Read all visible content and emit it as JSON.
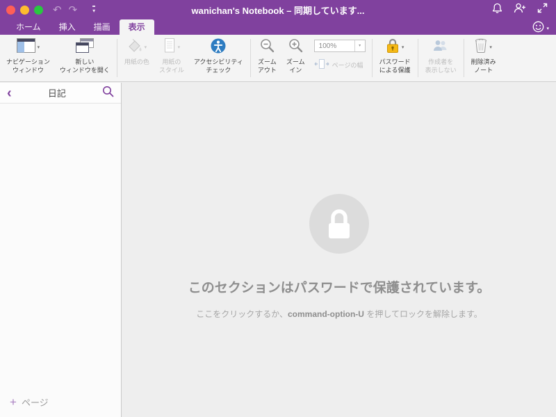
{
  "titlebar": {
    "title": "wanichan's Notebook – 同期しています...",
    "undo": "↶",
    "redo": "↷"
  },
  "tabs": {
    "home": "ホーム",
    "insert": "挿入",
    "draw": "描画",
    "view": "表示"
  },
  "ribbon": {
    "navigation_window": "ナビゲーション\nウィンドウ",
    "new_window": "新しい\nウィンドウを開く",
    "paper_color": "用紙の色",
    "paper_style": "用紙の\nスタイル",
    "accessibility_check": "アクセシビリティ\nチェック",
    "zoom_out": "ズーム\nアウト",
    "zoom_in": "ズーム\nイン",
    "zoom_level": "100%",
    "page_width": "ページの幅",
    "password_protect": "パスワード\nによる保護",
    "hide_authors": "作成者を\n表示しない",
    "deleted_notes": "削除済み\nノート"
  },
  "sidebar": {
    "section_title": "日記",
    "add_page": "ページ"
  },
  "content": {
    "locked_title": "このセクションはパスワードで保護されています。",
    "hint_prefix": "ここをクリックするか、",
    "hint_key": "command-option-U",
    "hint_suffix": " を押してロックを解除します。"
  },
  "colors": {
    "accent_purple": "#80419e",
    "ribbon_background": "#f4f4f4",
    "lock_yellow": "#f5b915",
    "accessibility_blue": "#2d7cc1",
    "traffic_red": "#ff5f57",
    "traffic_yellow": "#febc2e",
    "traffic_green": "#28c840"
  }
}
